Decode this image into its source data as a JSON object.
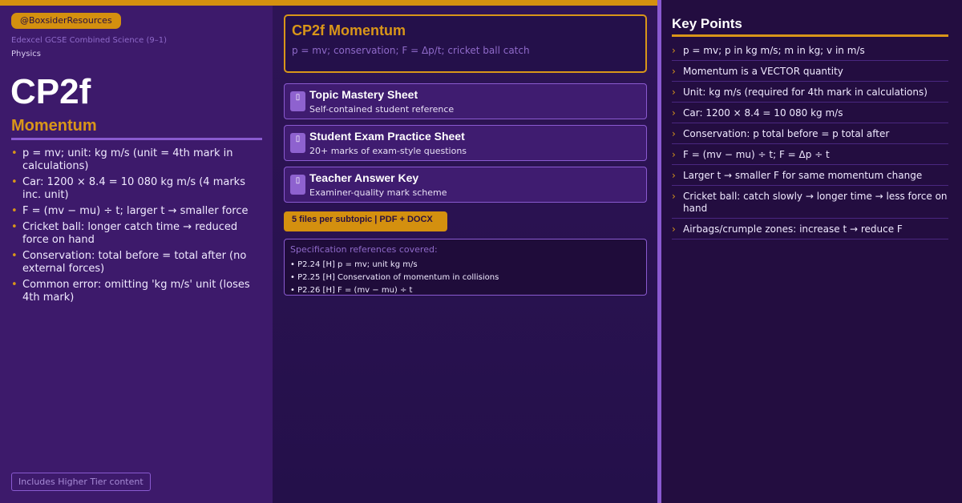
{
  "colors": {
    "accent": "#d99619",
    "panel": "#3d1a6b",
    "border": "#8a5ad0",
    "background": "#230d40"
  },
  "header": {
    "handle": "@BoxsiderResources",
    "course": "Edexcel GCSE Combined Science (9–1)",
    "subject": "Physics",
    "code": "CP2f",
    "topic": "Momentum"
  },
  "summary": [
    "p = mv; unit: kg m/s (unit = 4th mark in calculations)",
    "Car: 1200 × 8.4 = 10 080 kg m/s (4 marks inc. unit)",
    "F = (mv − mu) ÷ t; larger t → smaller force",
    "Cricket ball: longer catch time → reduced force on hand",
    "Conservation: total before = total after (no external forces)",
    "Common error: omitting 'kg m/s' unit (loses 4th mark)"
  ],
  "tier_note": "Includes Higher Tier content",
  "title_card": {
    "title": "CP2f Momentum",
    "subtitle": "p = mv; conservation; F = Δp/t; cricket ball catch"
  },
  "resources": [
    {
      "icon": "document-icon",
      "title": "Topic Mastery Sheet",
      "subtitle": "Self-contained student reference"
    },
    {
      "icon": "document-icon",
      "title": "Student Exam Practice Sheet",
      "subtitle": "20+ marks of exam-style questions"
    },
    {
      "icon": "document-icon",
      "title": "Teacher Answer Key",
      "subtitle": "Examiner-quality mark scheme"
    }
  ],
  "files_badge": "5 files per subtopic  |  PDF + DOCX",
  "spec": {
    "heading": "Specification references covered:",
    "items": [
      "• P2.24  [H] p = mv; unit kg m/s",
      "• P2.25  [H] Conservation of momentum in collisions",
      "• P2.26  [H] F = (mv − mu) ÷ t"
    ]
  },
  "key_points": {
    "title": "Key Points",
    "items": [
      "p = mv; p in kg m/s; m in kg; v in m/s",
      "Momentum is a VECTOR quantity",
      "Unit: kg m/s (required for 4th mark in calculations)",
      "Car: 1200 × 8.4 = 10 080 kg m/s",
      "Conservation: p total before = p total after",
      "F = (mv − mu) ÷ t; F = Δp ÷ t",
      "Larger t → smaller F for same momentum change",
      "Cricket ball: catch slowly → longer time → less force on hand",
      "Airbags/crumple zones: increase t → reduce F"
    ]
  }
}
